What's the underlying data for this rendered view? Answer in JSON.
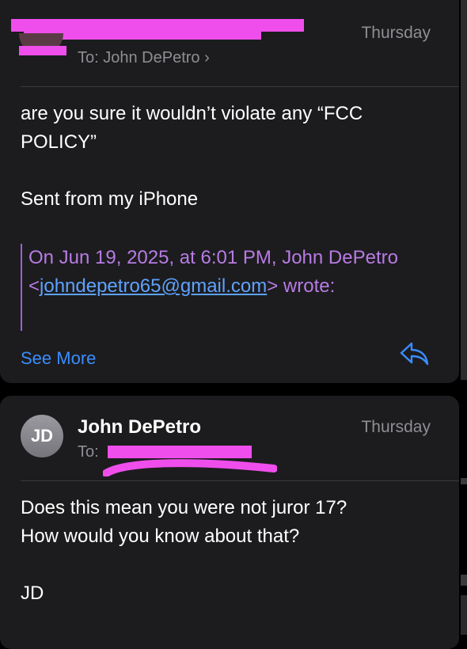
{
  "message1": {
    "date": "Thursday",
    "to_prefix": "To:",
    "to_name": "John DePetro",
    "to_chevron": "›",
    "body": "are you sure it wouldn’t violate any “FCC\nPOLICY”\n\nSent from my iPhone",
    "quote": {
      "prefix": "On Jun 19, 2025, at 6:01 PM, John DePetro",
      "email_open": "<",
      "email": "johndepetro65@gmail.com",
      "email_close": ">",
      "suffix": " wrote:"
    },
    "see_more": "See More",
    "reply_icon": "reply-arrow"
  },
  "message2": {
    "avatar_initials": "JD",
    "sender": "John DePetro",
    "date": "Thursday",
    "to_prefix": "To:",
    "body": "Does this mean you were not juror 17?\nHow would you know about that?\n\nJD"
  },
  "colors": {
    "background": "#000000",
    "card": "#1c1c1e",
    "secondary_text": "#8e8e93",
    "link": "#3a8dff",
    "quote": "#b87be4",
    "redaction": "#ef4eec"
  }
}
